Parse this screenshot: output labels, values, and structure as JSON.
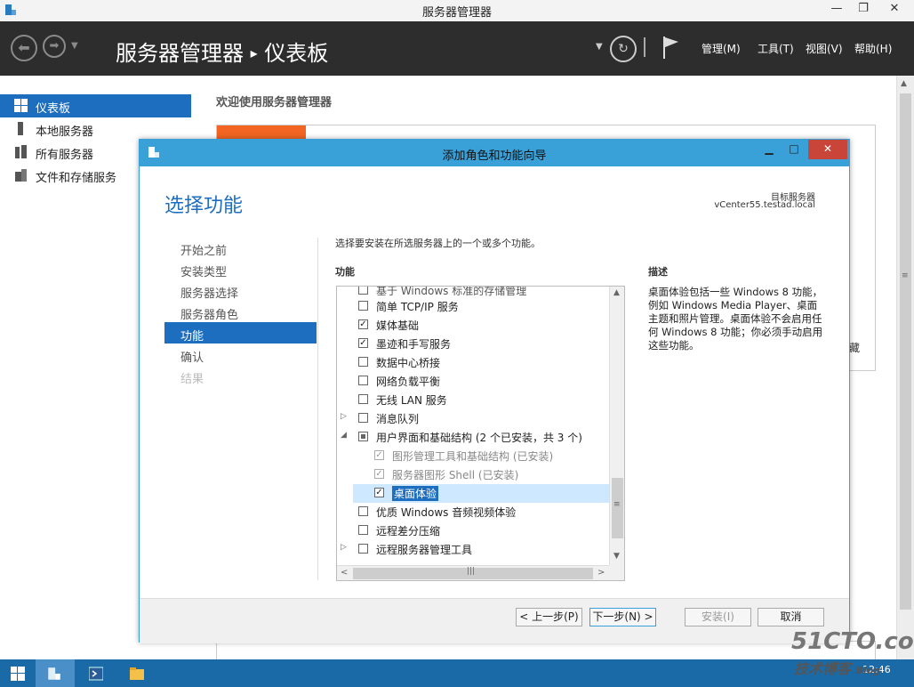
{
  "app": {
    "title": "服务器管理器",
    "breadcrumb_root": "服务器管理器",
    "breadcrumb_sep": "▸",
    "breadcrumb_page": "仪表板",
    "menus": [
      "管理(M)",
      "工具(T)",
      "视图(V)",
      "帮助(H)"
    ]
  },
  "sidebar": {
    "items": [
      {
        "label": "仪表板",
        "icon": "dashboard-grid-icon",
        "active": true
      },
      {
        "label": "本地服务器",
        "icon": "server-icon",
        "active": false
      },
      {
        "label": "所有服务器",
        "icon": "servers-icon",
        "active": false
      },
      {
        "label": "文件和存储服务",
        "icon": "storage-icon",
        "active": false
      }
    ]
  },
  "content": {
    "welcome": "欢迎使用服务器管理器",
    "tile_color": "#f26522",
    "clipped_text": "藏"
  },
  "dialog": {
    "title": "添加角色和功能向导",
    "page_title": "选择功能",
    "target_label": "目标服务器",
    "target_server": "vCenter55.testad.local",
    "steps": [
      "开始之前",
      "安装类型",
      "服务器选择",
      "服务器角色",
      "功能",
      "确认",
      "结果"
    ],
    "instructions": "选择要安装在所选服务器上的一个或多个功能。",
    "features_label": "功能",
    "desc_label": "描述",
    "description": "桌面体验包括一些 Windows 8 功能，例如 Windows Media Player、桌面主题和照片管理。桌面体验不会启用任何 Windows 8 功能；你必须手动启用这些功能。",
    "features": [
      {
        "label": "基于 Windows 标准的存储管理",
        "checked": false,
        "disabled": false,
        "expand": ""
      },
      {
        "label": "简单 TCP/IP 服务",
        "checked": false,
        "disabled": false,
        "expand": ""
      },
      {
        "label": "媒体基础",
        "checked": true,
        "disabled": false,
        "expand": ""
      },
      {
        "label": "墨迹和手写服务",
        "checked": true,
        "disabled": false,
        "expand": ""
      },
      {
        "label": "数据中心桥接",
        "checked": false,
        "disabled": false,
        "expand": ""
      },
      {
        "label": "网络负载平衡",
        "checked": false,
        "disabled": false,
        "expand": ""
      },
      {
        "label": "无线 LAN 服务",
        "checked": false,
        "disabled": false,
        "expand": ""
      },
      {
        "label": "消息队列",
        "checked": false,
        "disabled": false,
        "expand": "▷"
      },
      {
        "label": "用户界面和基础结构 (2 个已安装，共 3 个)",
        "checked": "partial",
        "disabled": false,
        "expand": "◢"
      },
      {
        "label": "图形管理工具和基础结构 (已安装)",
        "checked": true,
        "disabled": true,
        "expand": "",
        "sub": true
      },
      {
        "label": "服务器图形 Shell (已安装)",
        "checked": true,
        "disabled": true,
        "expand": "",
        "sub": true
      },
      {
        "label": "桌面体验",
        "checked": true,
        "disabled": false,
        "expand": "",
        "sub": true,
        "selected": true
      },
      {
        "label": "优质 Windows 音频视频体验",
        "checked": false,
        "disabled": false,
        "expand": ""
      },
      {
        "label": "远程差分压缩",
        "checked": false,
        "disabled": false,
        "expand": ""
      },
      {
        "label": "远程服务器管理工具",
        "checked": false,
        "disabled": false,
        "expand": "▷"
      }
    ],
    "buttons": {
      "prev": "< 上一步(P)",
      "next": "下一步(N) >",
      "install": "安装(I)",
      "cancel": "取消"
    }
  },
  "taskbar": {
    "clock": "12:46"
  },
  "watermark": {
    "line1": "51CTO.com",
    "line2": "技术博客",
    "line3": "Blog"
  },
  "colors": {
    "accent": "#1e6ec0",
    "dialog_title": "#3aa0d8",
    "header": "#2d2d2d",
    "taskbar": "#1b6aa8"
  }
}
